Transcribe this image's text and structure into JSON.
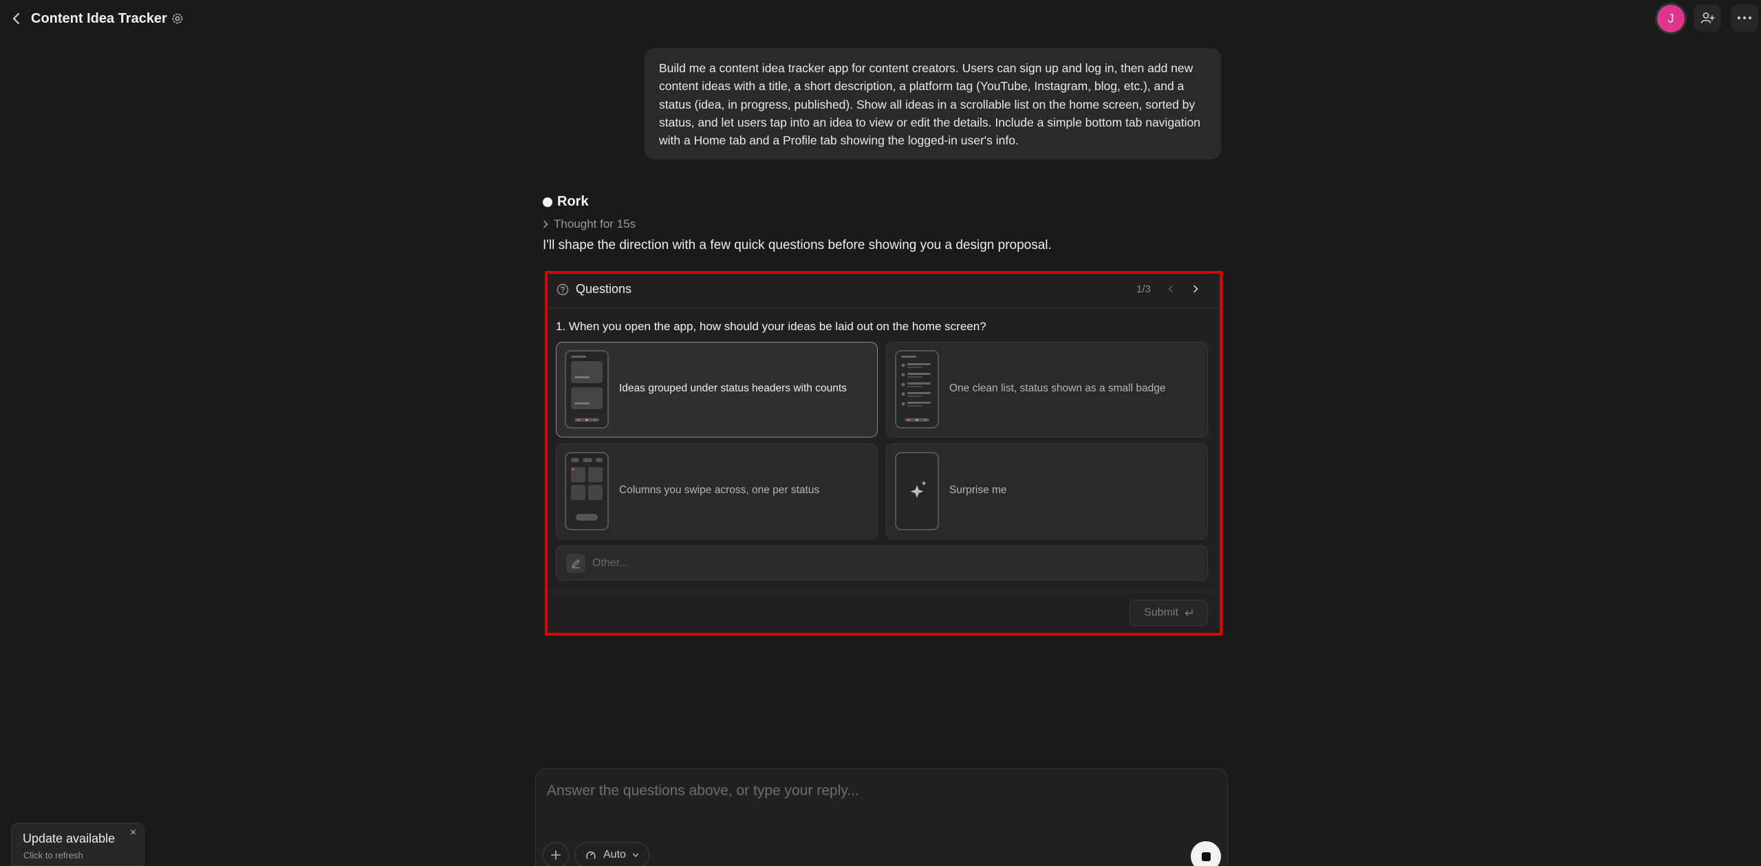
{
  "header": {
    "title": "Content Idea Tracker",
    "avatar_initial": "J"
  },
  "user_message": "Build me a content idea tracker app for content creators. Users can sign up and log in, then add new content ideas with a title, a short description, a platform tag (YouTube, Instagram, blog, etc.), and a status (idea, in progress, published). Show all ideas in a scrollable list on the home screen, sorted by status, and let users tap into an idea to view or edit the details. Include a simple bottom tab navigation with a Home tab and a Profile tab showing the logged-in user's info.",
  "assistant": {
    "name": "Rork",
    "thought": "Thought for 15s",
    "intro": "I'll shape the direction with a few quick questions before showing you a design proposal."
  },
  "questions": {
    "title": "Questions",
    "counter": "1/3",
    "question": "1. When you open the app, how should your ideas be laid out on the home screen?",
    "options": [
      {
        "label": "Ideas grouped under status headers with counts",
        "selected": true
      },
      {
        "label": "One clean list, status shown as a small badge",
        "selected": false
      },
      {
        "label": "Columns you swipe across, one per status",
        "selected": false
      },
      {
        "label": "Surprise me",
        "selected": false
      }
    ],
    "other_placeholder": "Other...",
    "submit_label": "Submit"
  },
  "composer": {
    "placeholder": "Answer the questions above, or type your reply...",
    "mode_label": "Auto"
  },
  "toast": {
    "title": "Update available",
    "subtitle": "Click to refresh",
    "close": "×"
  },
  "colors": {
    "background": "#1a1a1a",
    "avatar": "#e0358c",
    "highlight": "#e00000",
    "accent_dot": "#e0555e"
  }
}
